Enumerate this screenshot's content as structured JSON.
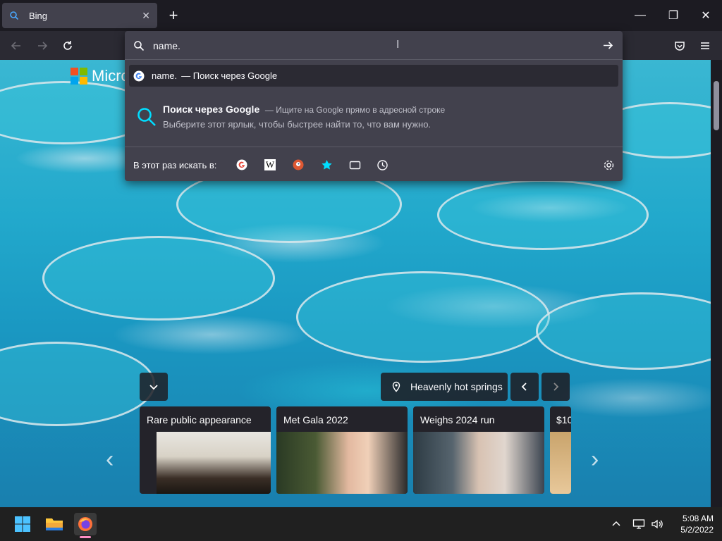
{
  "browser": {
    "tab": {
      "title": "Bing"
    },
    "window_controls": [
      "minimize",
      "restore",
      "close"
    ]
  },
  "urlbar": {
    "value": "name.",
    "suggestion_primary": {
      "text": "name.",
      "suffix": "— Поиск через Google"
    },
    "suggestion_tip": {
      "title": "Поиск через Google",
      "title_suffix": "— Ищите на Google прямо в адресной строке",
      "subtitle": "Выберите этот ярлык, чтобы быстрее найти то, что вам нужно."
    },
    "one_off_label": "В этот раз искать в:",
    "one_off_engines": [
      "google-icon",
      "wikipedia-icon",
      "duckduckgo-icon",
      "bookmarks-star-icon",
      "tabs-icon",
      "history-icon"
    ]
  },
  "page": {
    "logo_text": "Micro",
    "location_label": "Heavenly hot springs",
    "news_cards": [
      {
        "title": "Rare public appearance"
      },
      {
        "title": "Met Gala 2022"
      },
      {
        "title": "Weighs 2024 run"
      },
      {
        "title": "$10"
      }
    ]
  },
  "taskbar": {
    "time": "5:08 AM",
    "date": "5/2/2022"
  },
  "colors": {
    "accent": "#00ddff",
    "panel": "#42414d",
    "toolbar": "#2b2a33"
  }
}
